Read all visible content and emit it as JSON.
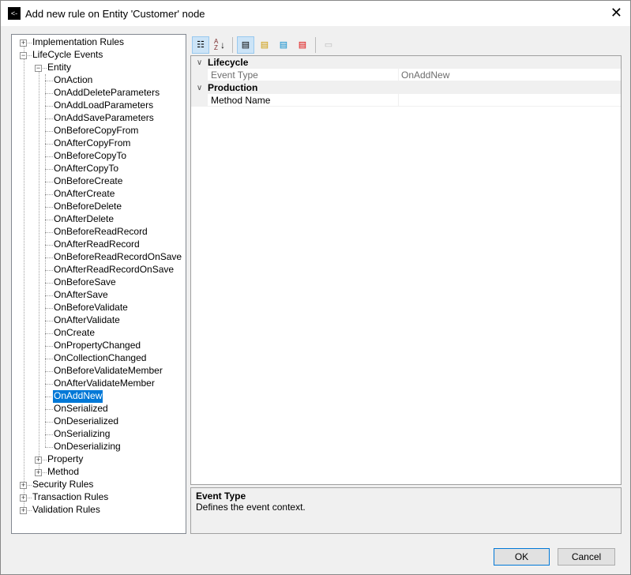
{
  "window": {
    "title": "Add new rule on Entity 'Customer' node",
    "close": "✕",
    "icon": "back-arrow-icon"
  },
  "tree": [
    {
      "label": "Implementation Rules",
      "level": 0,
      "expander": "+"
    },
    {
      "label": "LifeCycle Events",
      "level": 0,
      "expander": "-"
    },
    {
      "label": "Entity",
      "level": 1,
      "expander": "-"
    },
    {
      "label": "OnAction",
      "level": 2
    },
    {
      "label": "OnAddDeleteParameters",
      "level": 2
    },
    {
      "label": "OnAddLoadParameters",
      "level": 2
    },
    {
      "label": "OnAddSaveParameters",
      "level": 2
    },
    {
      "label": "OnBeforeCopyFrom",
      "level": 2
    },
    {
      "label": "OnAfterCopyFrom",
      "level": 2
    },
    {
      "label": "OnBeforeCopyTo",
      "level": 2
    },
    {
      "label": "OnAfterCopyTo",
      "level": 2
    },
    {
      "label": "OnBeforeCreate",
      "level": 2
    },
    {
      "label": "OnAfterCreate",
      "level": 2
    },
    {
      "label": "OnBeforeDelete",
      "level": 2
    },
    {
      "label": "OnAfterDelete",
      "level": 2
    },
    {
      "label": "OnBeforeReadRecord",
      "level": 2
    },
    {
      "label": "OnAfterReadRecord",
      "level": 2
    },
    {
      "label": "OnBeforeReadRecordOnSave",
      "level": 2
    },
    {
      "label": "OnAfterReadRecordOnSave",
      "level": 2
    },
    {
      "label": "OnBeforeSave",
      "level": 2
    },
    {
      "label": "OnAfterSave",
      "level": 2
    },
    {
      "label": "OnBeforeValidate",
      "level": 2
    },
    {
      "label": "OnAfterValidate",
      "level": 2
    },
    {
      "label": "OnCreate",
      "level": 2
    },
    {
      "label": "OnPropertyChanged",
      "level": 2
    },
    {
      "label": "OnCollectionChanged",
      "level": 2
    },
    {
      "label": "OnBeforeValidateMember",
      "level": 2
    },
    {
      "label": "OnAfterValidateMember",
      "level": 2
    },
    {
      "label": "OnAddNew",
      "level": 2,
      "selected": true
    },
    {
      "label": "OnSerialized",
      "level": 2
    },
    {
      "label": "OnDeserialized",
      "level": 2
    },
    {
      "label": "OnSerializing",
      "level": 2
    },
    {
      "label": "OnDeserializing",
      "level": 2
    },
    {
      "label": "Property",
      "level": 1,
      "expander": "+"
    },
    {
      "label": "Method",
      "level": 1,
      "expander": "+"
    },
    {
      "label": "Security Rules",
      "level": 0,
      "expander": "+"
    },
    {
      "label": "Transaction Rules",
      "level": 0,
      "expander": "+"
    },
    {
      "label": "Validation Rules",
      "level": 0,
      "expander": "+"
    }
  ],
  "toolbar": {
    "categorized": "categorized-icon",
    "alphabetical": "A Z",
    "properties": "properties-icon",
    "events": "events-icon",
    "pages": "property-pages-icon"
  },
  "grid": {
    "categories": [
      {
        "name": "Lifecycle",
        "props": [
          {
            "name": "Event Type",
            "value": "OnAddNew",
            "readonly": true
          }
        ]
      },
      {
        "name": "Production",
        "props": [
          {
            "name": "Method Name",
            "value": ""
          }
        ]
      }
    ]
  },
  "description": {
    "title": "Event Type",
    "text": "Defines the event context."
  },
  "buttons": {
    "ok": "OK",
    "cancel": "Cancel"
  },
  "colors": {
    "selection": "#0078d7"
  }
}
